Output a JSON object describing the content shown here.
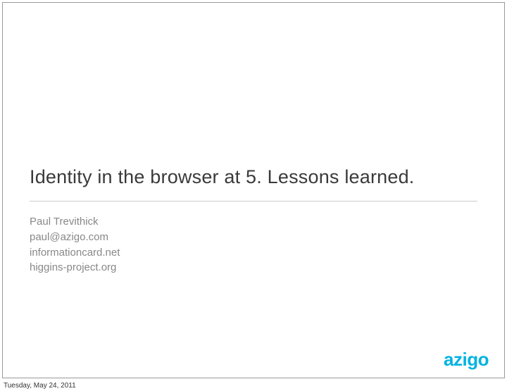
{
  "slide": {
    "title": "Identity in the browser at 5. Lessons learned.",
    "author": {
      "name": "Paul Trevithick",
      "email": "paul@azigo.com",
      "site1": "informationcard.net",
      "site2": "higgins-project.org"
    },
    "logo_text": "azigo"
  },
  "footer": {
    "date": "Tuesday, May 24, 2011"
  }
}
